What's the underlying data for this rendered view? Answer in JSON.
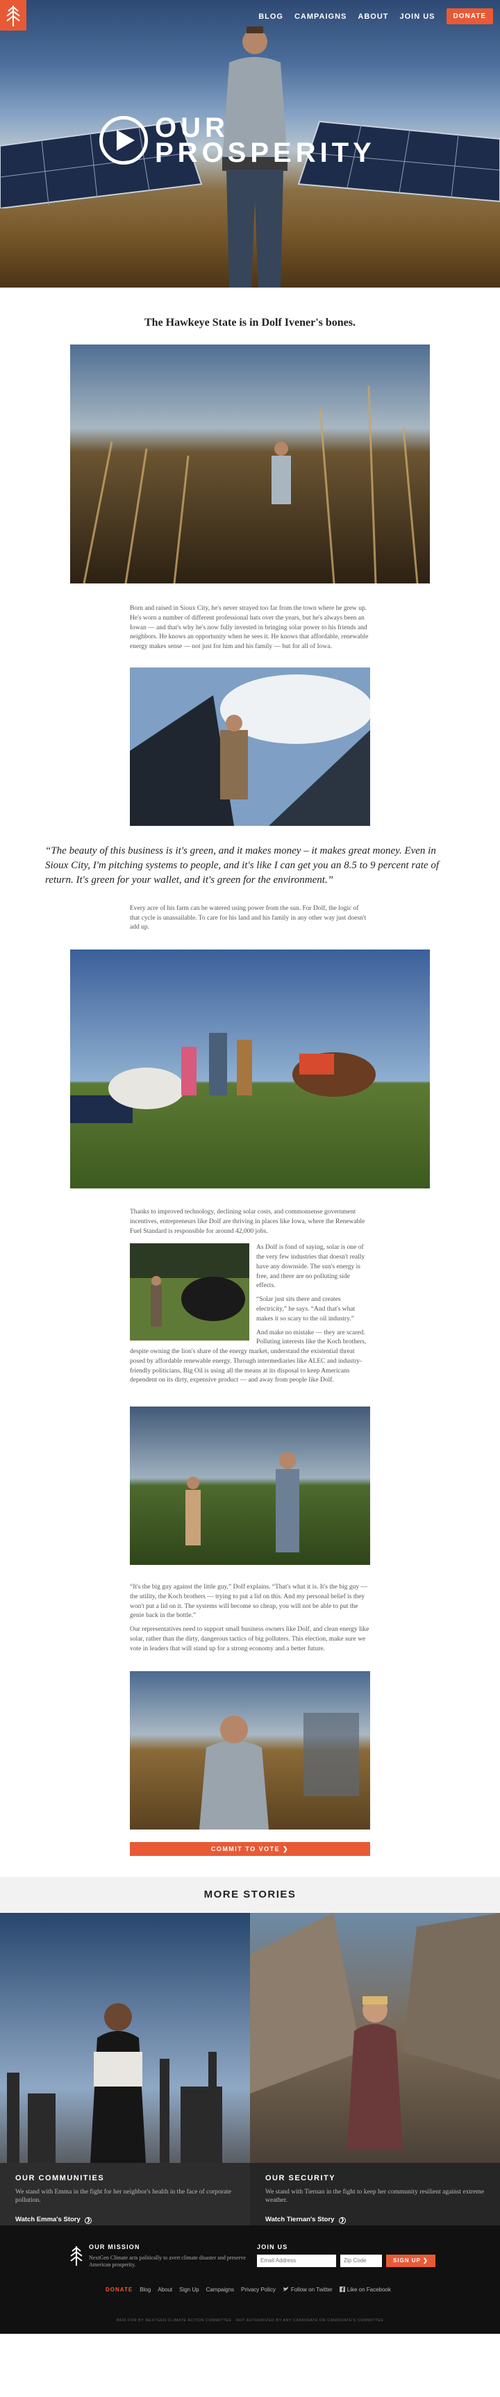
{
  "nav": {
    "items": [
      "BLOG",
      "CAMPAIGNS",
      "ABOUT",
      "JOIN US"
    ],
    "donate": "DONATE",
    "logo": "tree-icon"
  },
  "hero": {
    "title_line1": "OUR",
    "title_line2": "PROSPERITY",
    "play_icon": "play-icon"
  },
  "article": {
    "subtitle": "The Hawkeye State is in Dolf Ivener's bones.",
    "para1": "Born and raised in Sioux City, he's never strayed too far from the town where he grew up. He's worn a number of different professional hats over the years, but he's always been an Iowan — and that's why he's now fully invested in bringing solar power to his friends and neighbors. He knows an opportunity when he sees it. He knows that affordable, renewable energy makes sense — not just for him and his family — but for all of Iowa.",
    "quote": "“The beauty of this business is it's green, and it makes money – it makes great money. Even in Sioux City, I'm pitching systems to people, and it's like I can get you an 8.5 to 9 percent rate of return. It's green for your wallet, and it's green for the environment.”",
    "para2": "Every acre of his farm can be watered using power from the sun. For Dolf, the logic of that cycle is unassailable. To care for his land and his family in any other way just doesn't add up.",
    "para3": "Thanks to improved technology, declining solar costs, and commonsense government incentives, entrepreneurs like Dolf are thriving in places like Iowa, where the Renewable Fuel Standard is responsible for around 42,000 jobs.",
    "para4": "As Dolf is fond of saying, solar is one of the very few industries that doesn't really have any downside. The sun's energy is free, and there are no polluting side effects.",
    "para5": "“Solar just sits there and creates electricity,” he says. “And that's what makes it so scary to the oil industry.”",
    "para6": "And make no mistake — they are scared. Polluting interests like the Koch brothers, despite owning the lion's share of the energy market, understand the existential threat posed by affordable renewable energy. Through intermediaries like ALEC and industry-friendly politicians, Big Oil is using all the means at its disposal to keep Americans dependent on its dirty, expensive product — and away from people like Dolf.",
    "para7": "“It's the big guy against the little guy,” Dolf explains. “That's what it is. It's the big guy — the utility, the Koch brothers — trying to put a lid on this. And my personal belief is they won't put a lid on it. The systems will become so cheap, you will not be able to put the genie back in the bottle.”",
    "para8": "Our representatives need to support small business owners like Dolf, and clean energy like solar, rather than the dirty, dangerous tactics of big polluters. This election, make sure we vote in leaders that will stand up for a strong economy and a better future.",
    "cta": "COMMIT TO VOTE ❯"
  },
  "more": {
    "heading": "MORE STORIES",
    "stories": [
      {
        "title": "OUR COMMUNITIES",
        "text": "We stand with Emma in the fight for her neighbor's health in the face of corporate pollution.",
        "link": "Watch Emma's Story"
      },
      {
        "title": "OUR SECURITY",
        "text": "We stand with Tiernan in the fight to keep her community resilient against extreme weather.",
        "link": "Watch Tiernan's Story"
      }
    ]
  },
  "footer": {
    "mission_title": "OUR MISSION",
    "mission_text": "NextGen Climate acts politically to avert climate disaster and preserve American prosperity.",
    "join_title": "JOIN US",
    "email_placeholder": "Email Address",
    "zip_placeholder": "Zip Code",
    "signup": "SIGN UP ❯",
    "links": [
      "DONATE",
      "Blog",
      "About",
      "Sign Up",
      "Campaigns",
      "Privacy Policy"
    ],
    "twitter": "Follow on Twitter",
    "facebook": "Like on Facebook",
    "legal": "PAID FOR BY NEXTGEN CLIMATE ACTION COMMITTEE · NOT AUTHORIZED BY ANY CANDIDATE OR CANDIDATE'S COMMITTEE"
  },
  "colors": {
    "accent": "#e85a35",
    "dark": "#2d2d2d",
    "footer": "#111111"
  }
}
